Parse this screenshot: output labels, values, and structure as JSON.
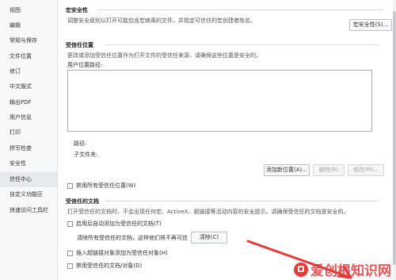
{
  "sidebar": {
    "items": [
      {
        "label": "视图"
      },
      {
        "label": "编辑"
      },
      {
        "label": "常规与保存"
      },
      {
        "label": "文件位置"
      },
      {
        "label": "修订"
      },
      {
        "label": "中文版式"
      },
      {
        "label": "输出PDF"
      },
      {
        "label": "用户信息"
      },
      {
        "label": "打印"
      },
      {
        "label": "拼写检查"
      },
      {
        "label": "安全性"
      },
      {
        "label": "信任中心"
      },
      {
        "label": "自定义功能区"
      },
      {
        "label": "快速访问工具栏"
      }
    ],
    "active_index": 11
  },
  "macro": {
    "title": "宏安全性",
    "description": "调整安全级别以打开可能包含宏病毒的文件，并指定可信任的宏创建者姓名。",
    "button": "宏安全性(S)..."
  },
  "trusted_locations": {
    "title": "受信任位置",
    "description": "更改或添加受信任位置作为打开文件的受信任来源，请确保这些位置是安全的。",
    "list_label": "用户位置路径:",
    "path_label": "路径:",
    "subfolder_label": "子文件夹:",
    "add_button": "添加新位置(A)...",
    "delete_button": "删除(R)",
    "modify_button": "修改(M)...",
    "disable_all": "禁用所有受信任位置(W)"
  },
  "trusted_documents": {
    "title": "受信任的文档",
    "description": "打开受信任的文档时，不会出现任何宏、ActiveX、超链接等活动内容的安全提示。请确保受信任的文档是安全的。",
    "auto_add": "启用后自动添加为受信任的文档(T)",
    "clear_text": "清除所有受信任的文档，这样他们将不再可信",
    "clear_button": "清除(C)",
    "insert_hyperlink": "插入超链接对象添加为受信任对象(H)",
    "disable_all": "禁用受信任的文档/对象(D)"
  },
  "watermark": {
    "text": "爱创根知识网"
  },
  "colors": {
    "accent": "#e43a3a",
    "sidebar_bg": "#f7f8fa",
    "active_bg": "#e6e9ee"
  }
}
